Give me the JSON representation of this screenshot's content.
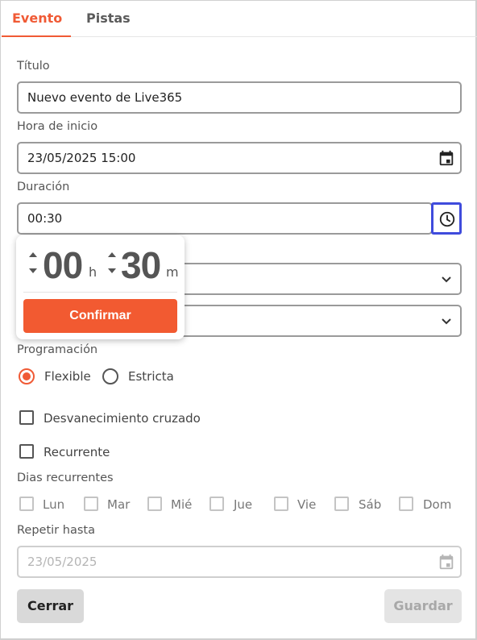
{
  "tabs": [
    {
      "label": "Evento",
      "active": true
    },
    {
      "label": "Pistas",
      "active": false
    }
  ],
  "form": {
    "titulo_label": "Título",
    "titulo_value": "Nuevo evento de Live365",
    "hora_label": "Hora de inicio",
    "hora_value": "23/05/2025 15:00",
    "duracion_label": "Duración",
    "duracion_value": "00:30",
    "programacion_label": "Programación",
    "programacion_options": [
      {
        "label": "Flexible",
        "selected": true
      },
      {
        "label": "Estricta",
        "selected": false
      }
    ],
    "crossfade_label": "Desvanecimiento cruzado",
    "recurrente_label": "Recurrente",
    "dias_label": "Dias recurrentes",
    "dias": [
      "Lun",
      "Mar",
      "Mié",
      "Jue",
      "Vie",
      "Sáb",
      "Dom"
    ],
    "repetir_label": "Repetir hasta",
    "repetir_value": "23/05/2025"
  },
  "duration_picker": {
    "hours": "00",
    "hours_unit": "h",
    "minutes": "30",
    "minutes_unit": "m",
    "confirm_label": "Confirmar"
  },
  "actions": {
    "cerrar_label": "Cerrar",
    "guardar_label": "Guardar"
  },
  "colors": {
    "accent": "#f05a35",
    "focus": "#3f4bdc"
  },
  "icons": {
    "date": "calendar-icon",
    "duration": "clock-icon",
    "dropdown": "chevron-down-icon"
  }
}
